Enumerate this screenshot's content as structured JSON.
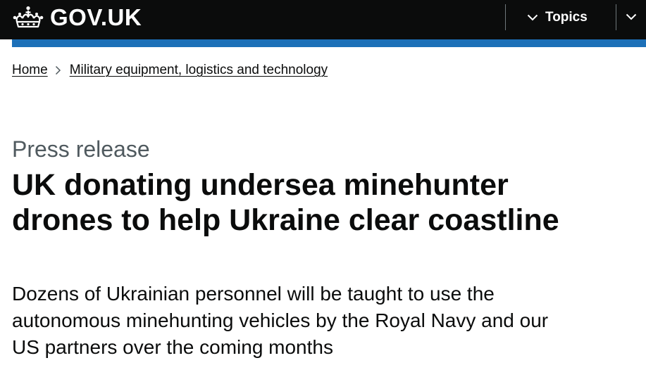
{
  "header": {
    "logo_text": "GOV.UK",
    "topics_label": "Topics",
    "background_color": "#0b0c0c",
    "stripe_color": "#1d70b8"
  },
  "breadcrumb": {
    "items": [
      {
        "label": "Home"
      },
      {
        "label": "Military equipment, logistics and technology"
      }
    ]
  },
  "article": {
    "caption": "Press release",
    "title": "UK donating undersea minehunter drones to help Ukraine clear coastline",
    "lead": "Dozens of Ukrainian personnel will be taught to use the autonomous minehunting vehicles by the Royal Navy and our US partners over the coming months"
  },
  "icons": {
    "logo": "crown-icon",
    "topics": "chevron-down-icon",
    "breadcrumb_separator": "chevron-right-icon"
  }
}
